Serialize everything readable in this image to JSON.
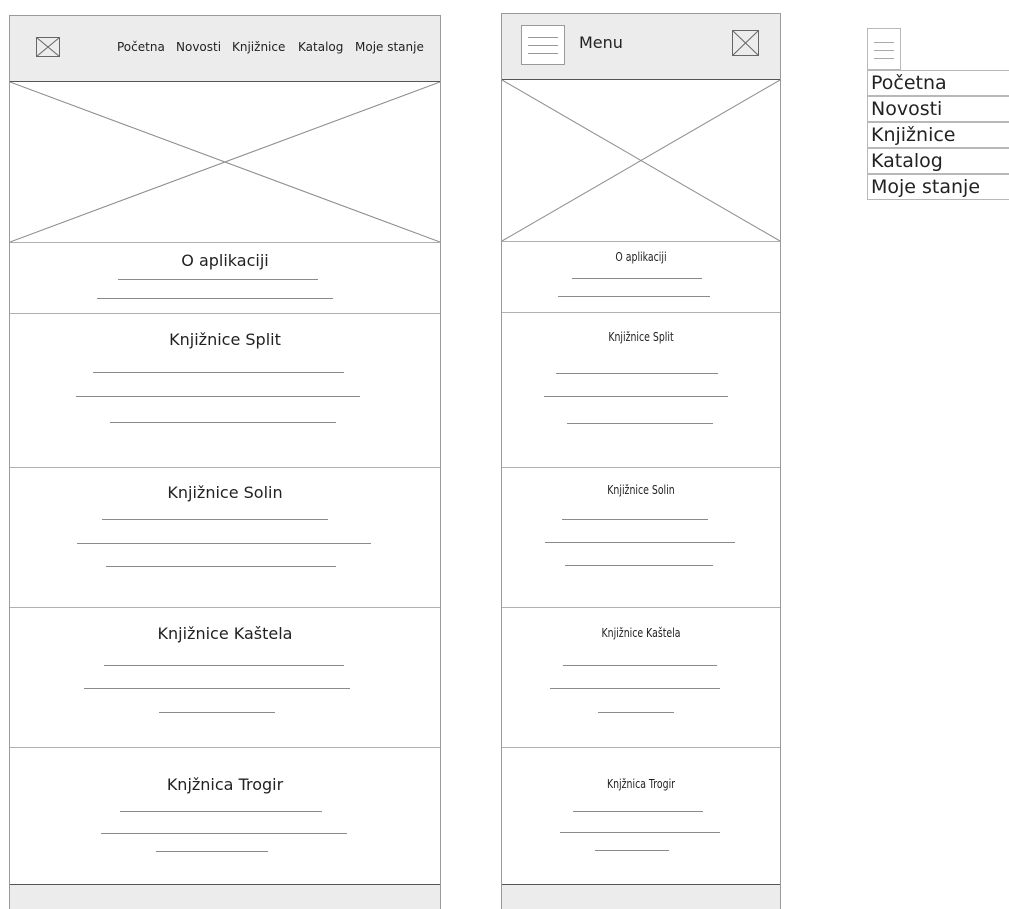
{
  "desktop": {
    "nav": [
      "Početna",
      "Novosti",
      "Knjižnice",
      "Katalog",
      "Moje stanje"
    ],
    "sections": [
      "O aplikaciji",
      "Knjižnice Split",
      "Knjižnice Solin",
      "Knjižnice Kaštela",
      "Knjžnica Trogir"
    ]
  },
  "mobile": {
    "menu_label": "Menu",
    "sections": [
      "O aplikaciji",
      "Knjižnice Split",
      "Knjižnice Solin",
      "Knjižnice Kaštela",
      "Knjžnica Trogir"
    ]
  },
  "dropdown": {
    "items": [
      "Početna",
      "Novosti",
      "Knjižnice",
      "Katalog",
      "Moje stanje"
    ]
  },
  "colors": {
    "header_bg": "#ececec",
    "line": "#8a8a8a",
    "border": "#555555"
  },
  "icons": [
    "image-placeholder-icon",
    "hamburger-menu-icon"
  ]
}
